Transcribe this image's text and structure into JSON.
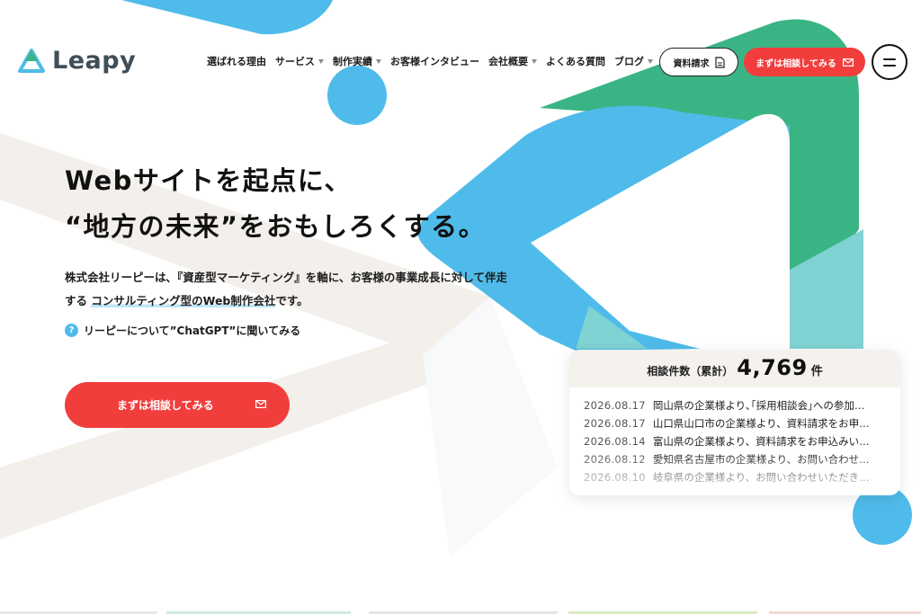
{
  "header": {
    "logo_text": "Leapy",
    "nav": [
      {
        "label": "選ばれる理由",
        "has_dropdown": false
      },
      {
        "label": "サービス",
        "has_dropdown": true
      },
      {
        "label": "制作実績",
        "has_dropdown": true
      },
      {
        "label": "お客様インタビュー",
        "has_dropdown": false
      },
      {
        "label": "会社概要",
        "has_dropdown": true
      },
      {
        "label": "よくある質問",
        "has_dropdown": false
      },
      {
        "label": "ブログ",
        "has_dropdown": true
      }
    ],
    "request_doc_label": "資料請求",
    "consult_label": "まずは相談してみる"
  },
  "hero": {
    "title_line1": "Webサイトを起点に、",
    "title_line2": "“地方の未来”をおもしろくする。",
    "desc_line1": "株式会社リーピーは､『資産型マーケティング』を軸に、お客様の事業成長に対して伴走",
    "desc_line2_pre": "する ",
    "desc_line2_highlight": "コンサルティング型のWeb制作会社",
    "desc_line2_post": "です。",
    "chatgpt_link": "リーピーについて”ChatGPT”に聞いてみる",
    "cta_label": "まずは相談してみる"
  },
  "counter": {
    "label": "相談件数（累計）",
    "count": "4,769",
    "unit": "件",
    "news": [
      {
        "date": "2026.08.17",
        "title": "岡山県の企業様より､｢採用相談会｣への参加…"
      },
      {
        "date": "2026.08.17",
        "title": "山口県山口市の企業様より、資料請求をお申…"
      },
      {
        "date": "2026.08.14",
        "title": "富山県の企業様より、資料請求をお申込みい…"
      },
      {
        "date": "2026.08.12",
        "title": "愛知県名古屋市の企業様より、お問い合わせ…"
      },
      {
        "date": "2026.08.10",
        "title": "岐阜県の企業様より、お問い合わせいただき…"
      }
    ]
  },
  "colors": {
    "brand_red": "#f23d3d",
    "sky_blue": "#4fbbea",
    "green": "#3bb485",
    "teal": "#7fd3d2",
    "beige": "#f3efea"
  },
  "icons": [
    "leapy-logo-icon",
    "caret-down-icon",
    "document-icon",
    "mail-icon",
    "hamburger-icon",
    "question-icon"
  ]
}
